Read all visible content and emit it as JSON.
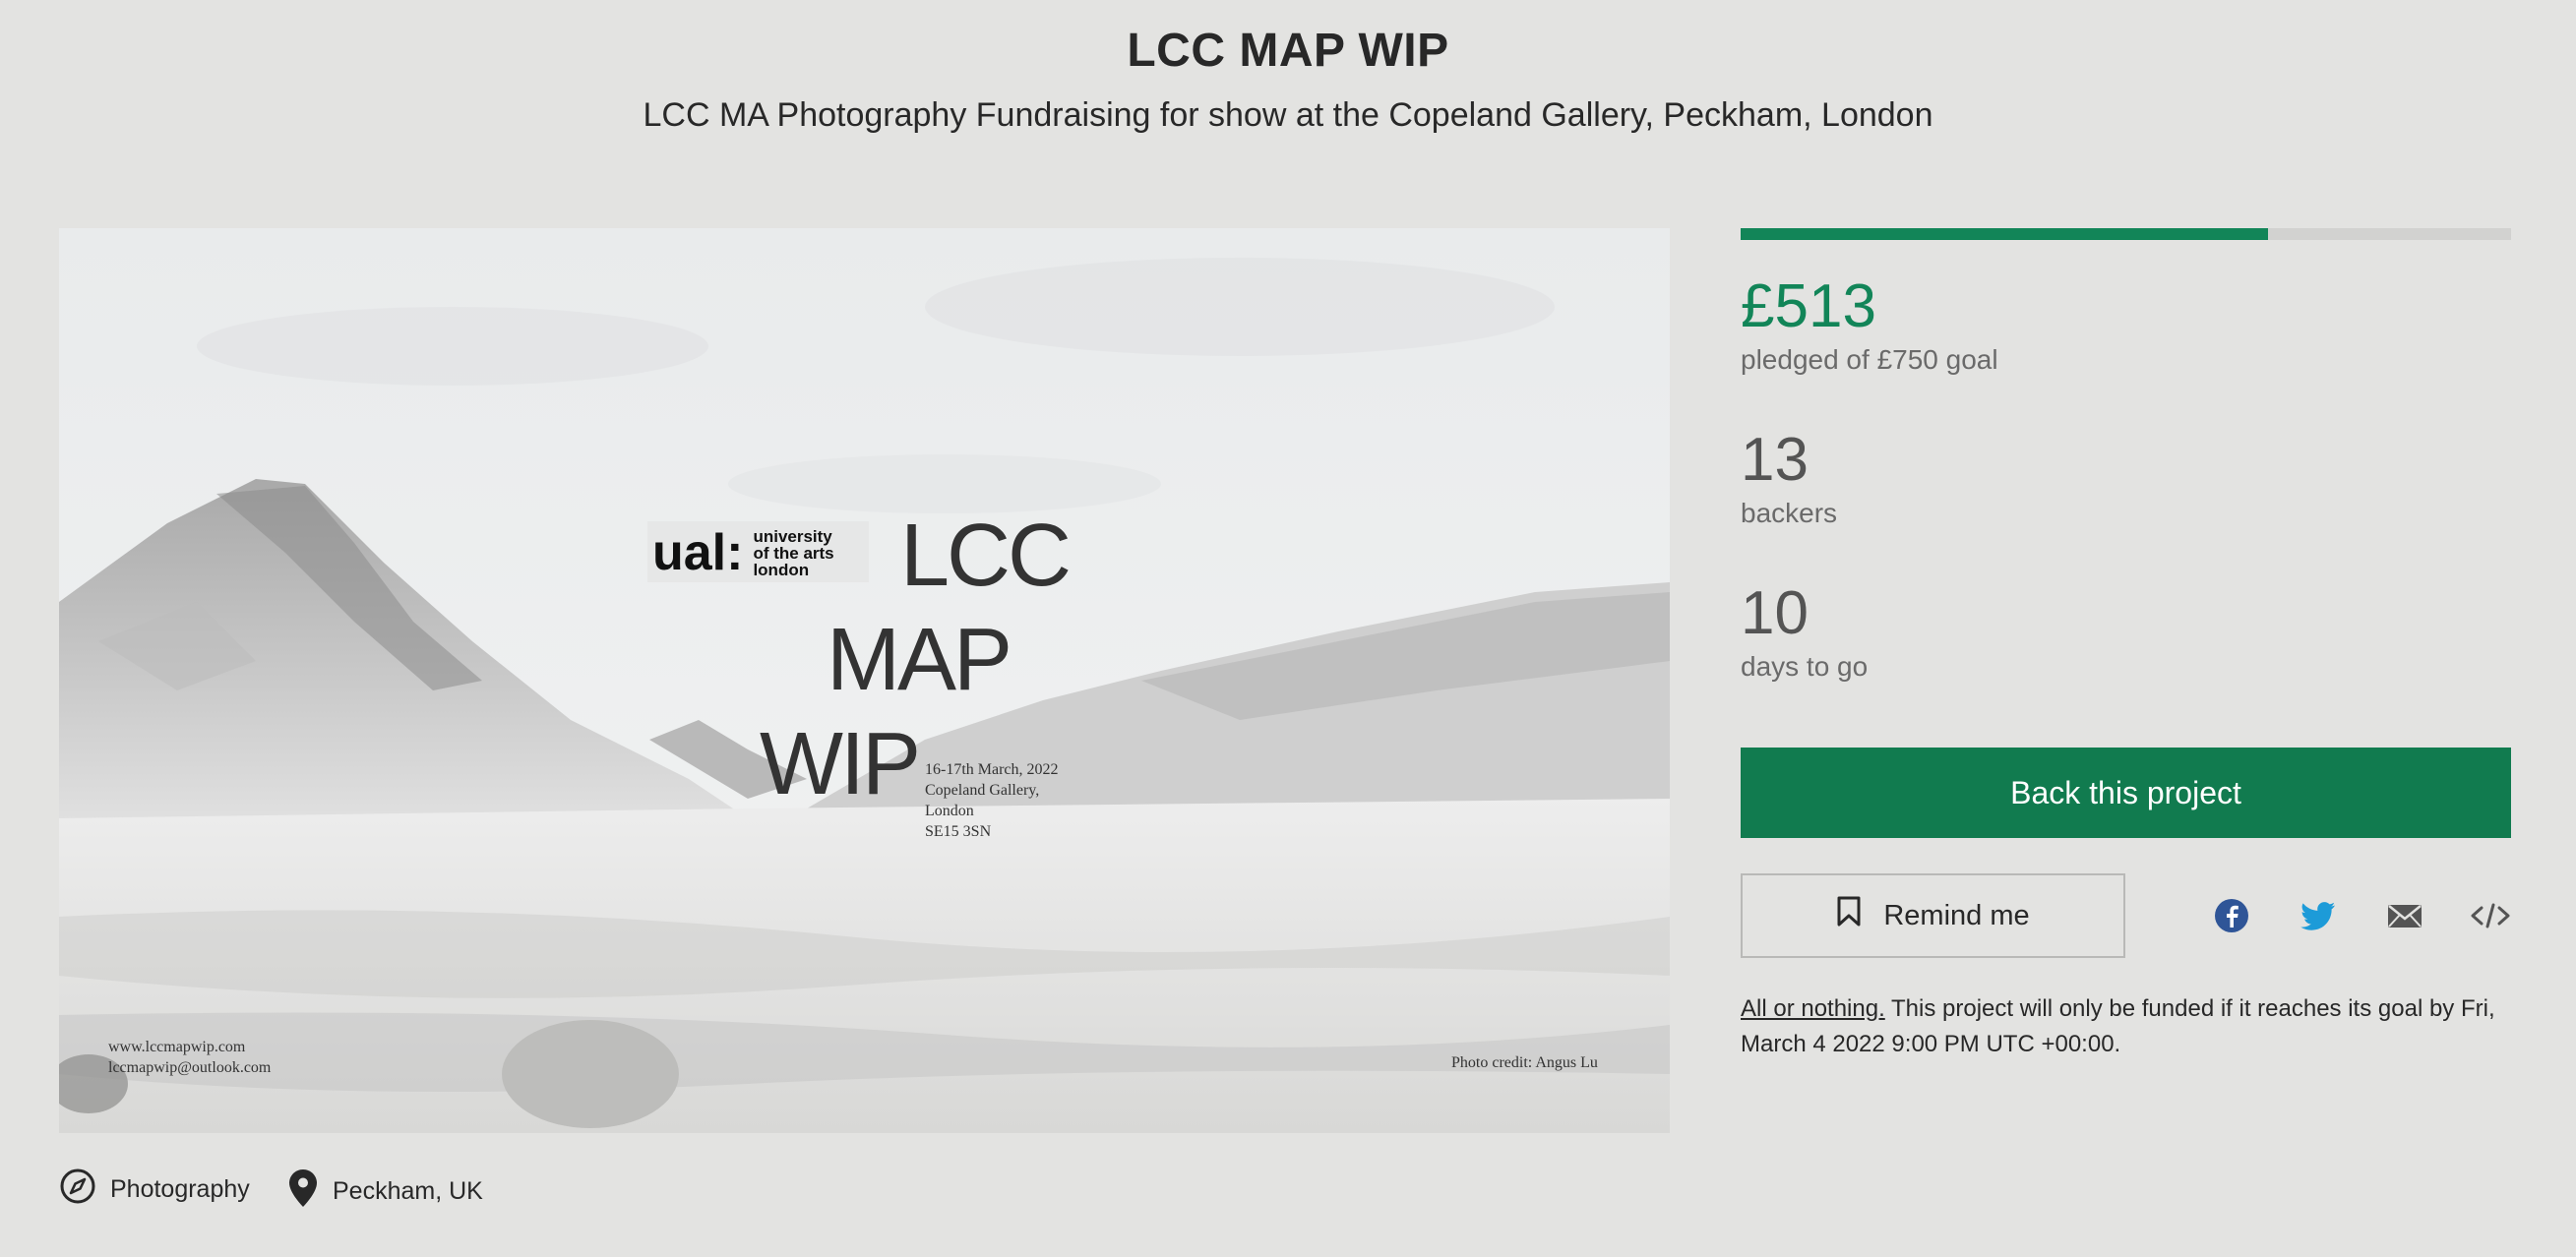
{
  "header": {
    "title": "LCC MAP WIP",
    "subtitle": "LCC MA Photography Fundraising for show at the Copeland Gallery, Peckham, London"
  },
  "hero": {
    "logo_mark": "ual:",
    "logo_text_line1": "university",
    "logo_text_line2": "of the arts",
    "logo_text_line3": "london",
    "word1": "LCC",
    "word2": "MAP",
    "word3": "WIP",
    "event_line1": "16-17th March, 2022",
    "event_line2": "Copeland Gallery,",
    "event_line3": "London",
    "event_line4": "SE15 3SN",
    "web": "www.lccmapwip.com",
    "email": "lccmapwip@outlook.com",
    "credit": "Photo credit: Angus Lu"
  },
  "funding": {
    "progress_fraction": 0.684,
    "pledged": "£513",
    "pledged_label": "pledged of £750 goal",
    "backers_count": "13",
    "backers_label": "backers",
    "days_count": "10",
    "days_label": "days to go"
  },
  "actions": {
    "back_label": "Back this project",
    "remind_label": "Remind me",
    "remind_icon": "bookmark-icon",
    "share_icons": [
      "facebook-icon",
      "twitter-icon",
      "email-icon",
      "embed-icon"
    ]
  },
  "note": {
    "emphasis": "All or nothing.",
    "text": " This project will only be funded if it reaches its goal by Fri, March 4 2022 9:00 PM UTC +00:00."
  },
  "meta": {
    "category": "Photography",
    "category_icon": "compass-icon",
    "location": "Peckham, UK",
    "location_icon": "map-pin-icon"
  },
  "colors": {
    "accent": "#128558",
    "button": "#117b4f",
    "background": "#e3e3e1",
    "facebook": "#2f5597",
    "twitter": "#1d9bd8"
  }
}
